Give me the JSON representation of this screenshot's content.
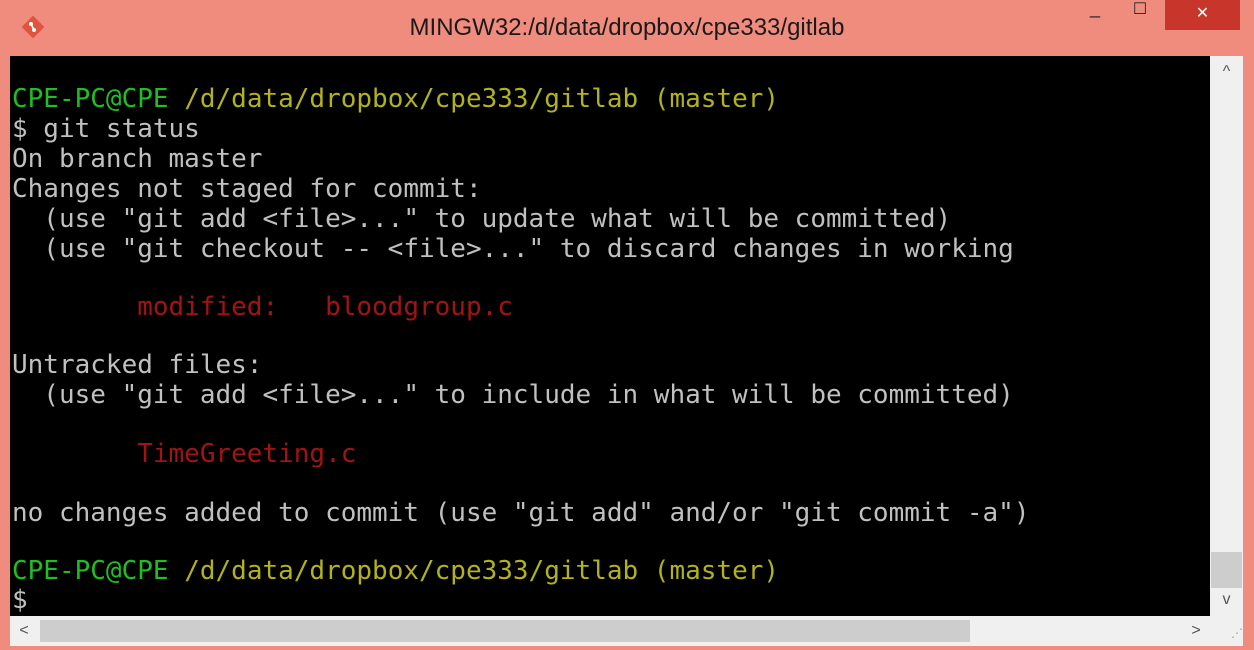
{
  "window": {
    "title": "MINGW32:/d/data/dropbox/cpe333/gitlab",
    "minimize_glyph": "_",
    "maximize_glyph": "☐",
    "close_glyph": "✕",
    "icon": "git-diamond-icon",
    "colors": {
      "titlebar": "#f08c7e",
      "close_button": "#c7352b",
      "terminal_bg": "#000000"
    }
  },
  "terminal": {
    "prompt1_userhost": "CPE-PC@CPE",
    "prompt1_path": "/d/data/dropbox/cpe333/gitlab (master)",
    "command": "$ git status",
    "on_branch": "On branch master",
    "changes_header": "Changes not staged for commit:",
    "hint_add": "  (use \"git add <file>...\" to update what will be committed)",
    "hint_checkout": "  (use \"git checkout -- <file>...\" to discard changes in working",
    "modified_entry": "        modified:   bloodgroup.c",
    "untracked_header": "Untracked files:",
    "hint_untracked": "  (use \"git add <file>...\" to include in what will be committed)",
    "untracked_file": "        TimeGreeting.c",
    "summary": "no changes added to commit (use \"git add\" and/or \"git commit -a\")",
    "prompt2_userhost": "CPE-PC@CPE",
    "prompt2_path": "/d/data/dropbox/cpe333/gitlab (master)",
    "cursor_prompt": "$"
  },
  "scrollbars": {
    "up": "^",
    "down": "v",
    "left": "<",
    "right": ">"
  }
}
